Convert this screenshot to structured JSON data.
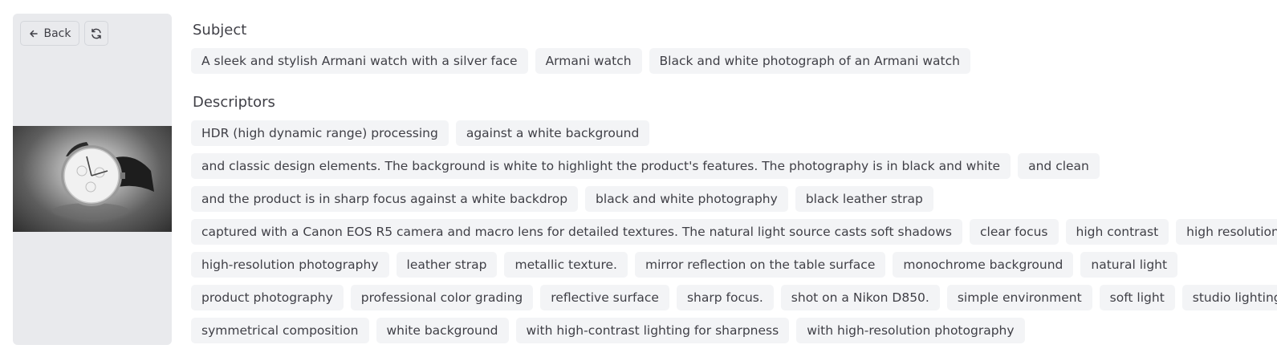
{
  "toolbar": {
    "back_label": "Back"
  },
  "subject": {
    "title": "Subject",
    "tags": [
      "A sleek and stylish Armani watch with a silver face",
      "Armani watch",
      "Black and white photograph of an Armani watch"
    ]
  },
  "descriptors": {
    "title": "Descriptors",
    "rows": [
      [
        "HDR (high dynamic range) processing",
        "against a white background"
      ],
      [
        "and classic design elements. The background is white to highlight the product's features. The photography is in black and white",
        "and clean"
      ],
      [
        "and the product is in sharp focus against a white backdrop",
        "black and white photography",
        "black leather strap"
      ],
      [
        "captured with a Canon EOS R5 camera and macro lens for detailed textures. The natural light source casts soft shadows",
        "clear focus",
        "high contrast",
        "high resolution"
      ],
      [
        "high-resolution photography",
        "leather strap",
        "metallic texture.",
        "mirror reflection on the table surface",
        "monochrome background",
        "natural light"
      ],
      [
        "product photography",
        "professional color grading",
        "reflective surface",
        "sharp focus.",
        "shot on a Nikon D850.",
        "simple environment",
        "soft light",
        "studio lighting"
      ],
      [
        "symmetrical composition",
        "white background",
        "with high-contrast lighting for sharpness",
        "with high-resolution photography"
      ]
    ]
  }
}
